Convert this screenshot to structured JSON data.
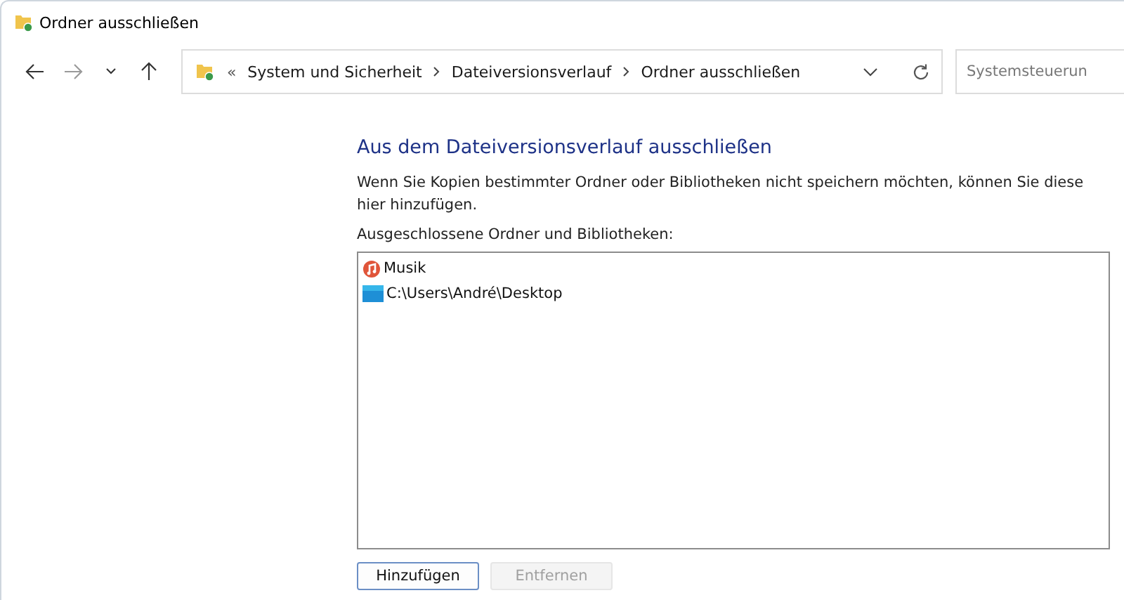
{
  "window": {
    "title": "Ordner ausschließen"
  },
  "address_bar": {
    "overflow": "«",
    "breadcrumbs": [
      "System und Sicherheit",
      "Dateiversionsverlauf",
      "Ordner ausschließen"
    ]
  },
  "search": {
    "placeholder": "Systemsteuerun"
  },
  "content": {
    "heading": "Aus dem Dateiversionsverlauf ausschließen",
    "description": "Wenn Sie Kopien bestimmter Ordner oder Bibliotheken nicht speichern möchten, können Sie diese hier hinzufügen.",
    "list_label": "Ausgeschlossene Ordner und Bibliotheken:",
    "items": [
      {
        "kind": "music",
        "label": "Musik"
      },
      {
        "kind": "desktop",
        "label": "C:\\Users\\André\\Desktop"
      }
    ]
  },
  "buttons": [
    {
      "label": "Hinzufügen",
      "disabled": false
    },
    {
      "label": "Entfernen",
      "disabled": true
    }
  ]
}
